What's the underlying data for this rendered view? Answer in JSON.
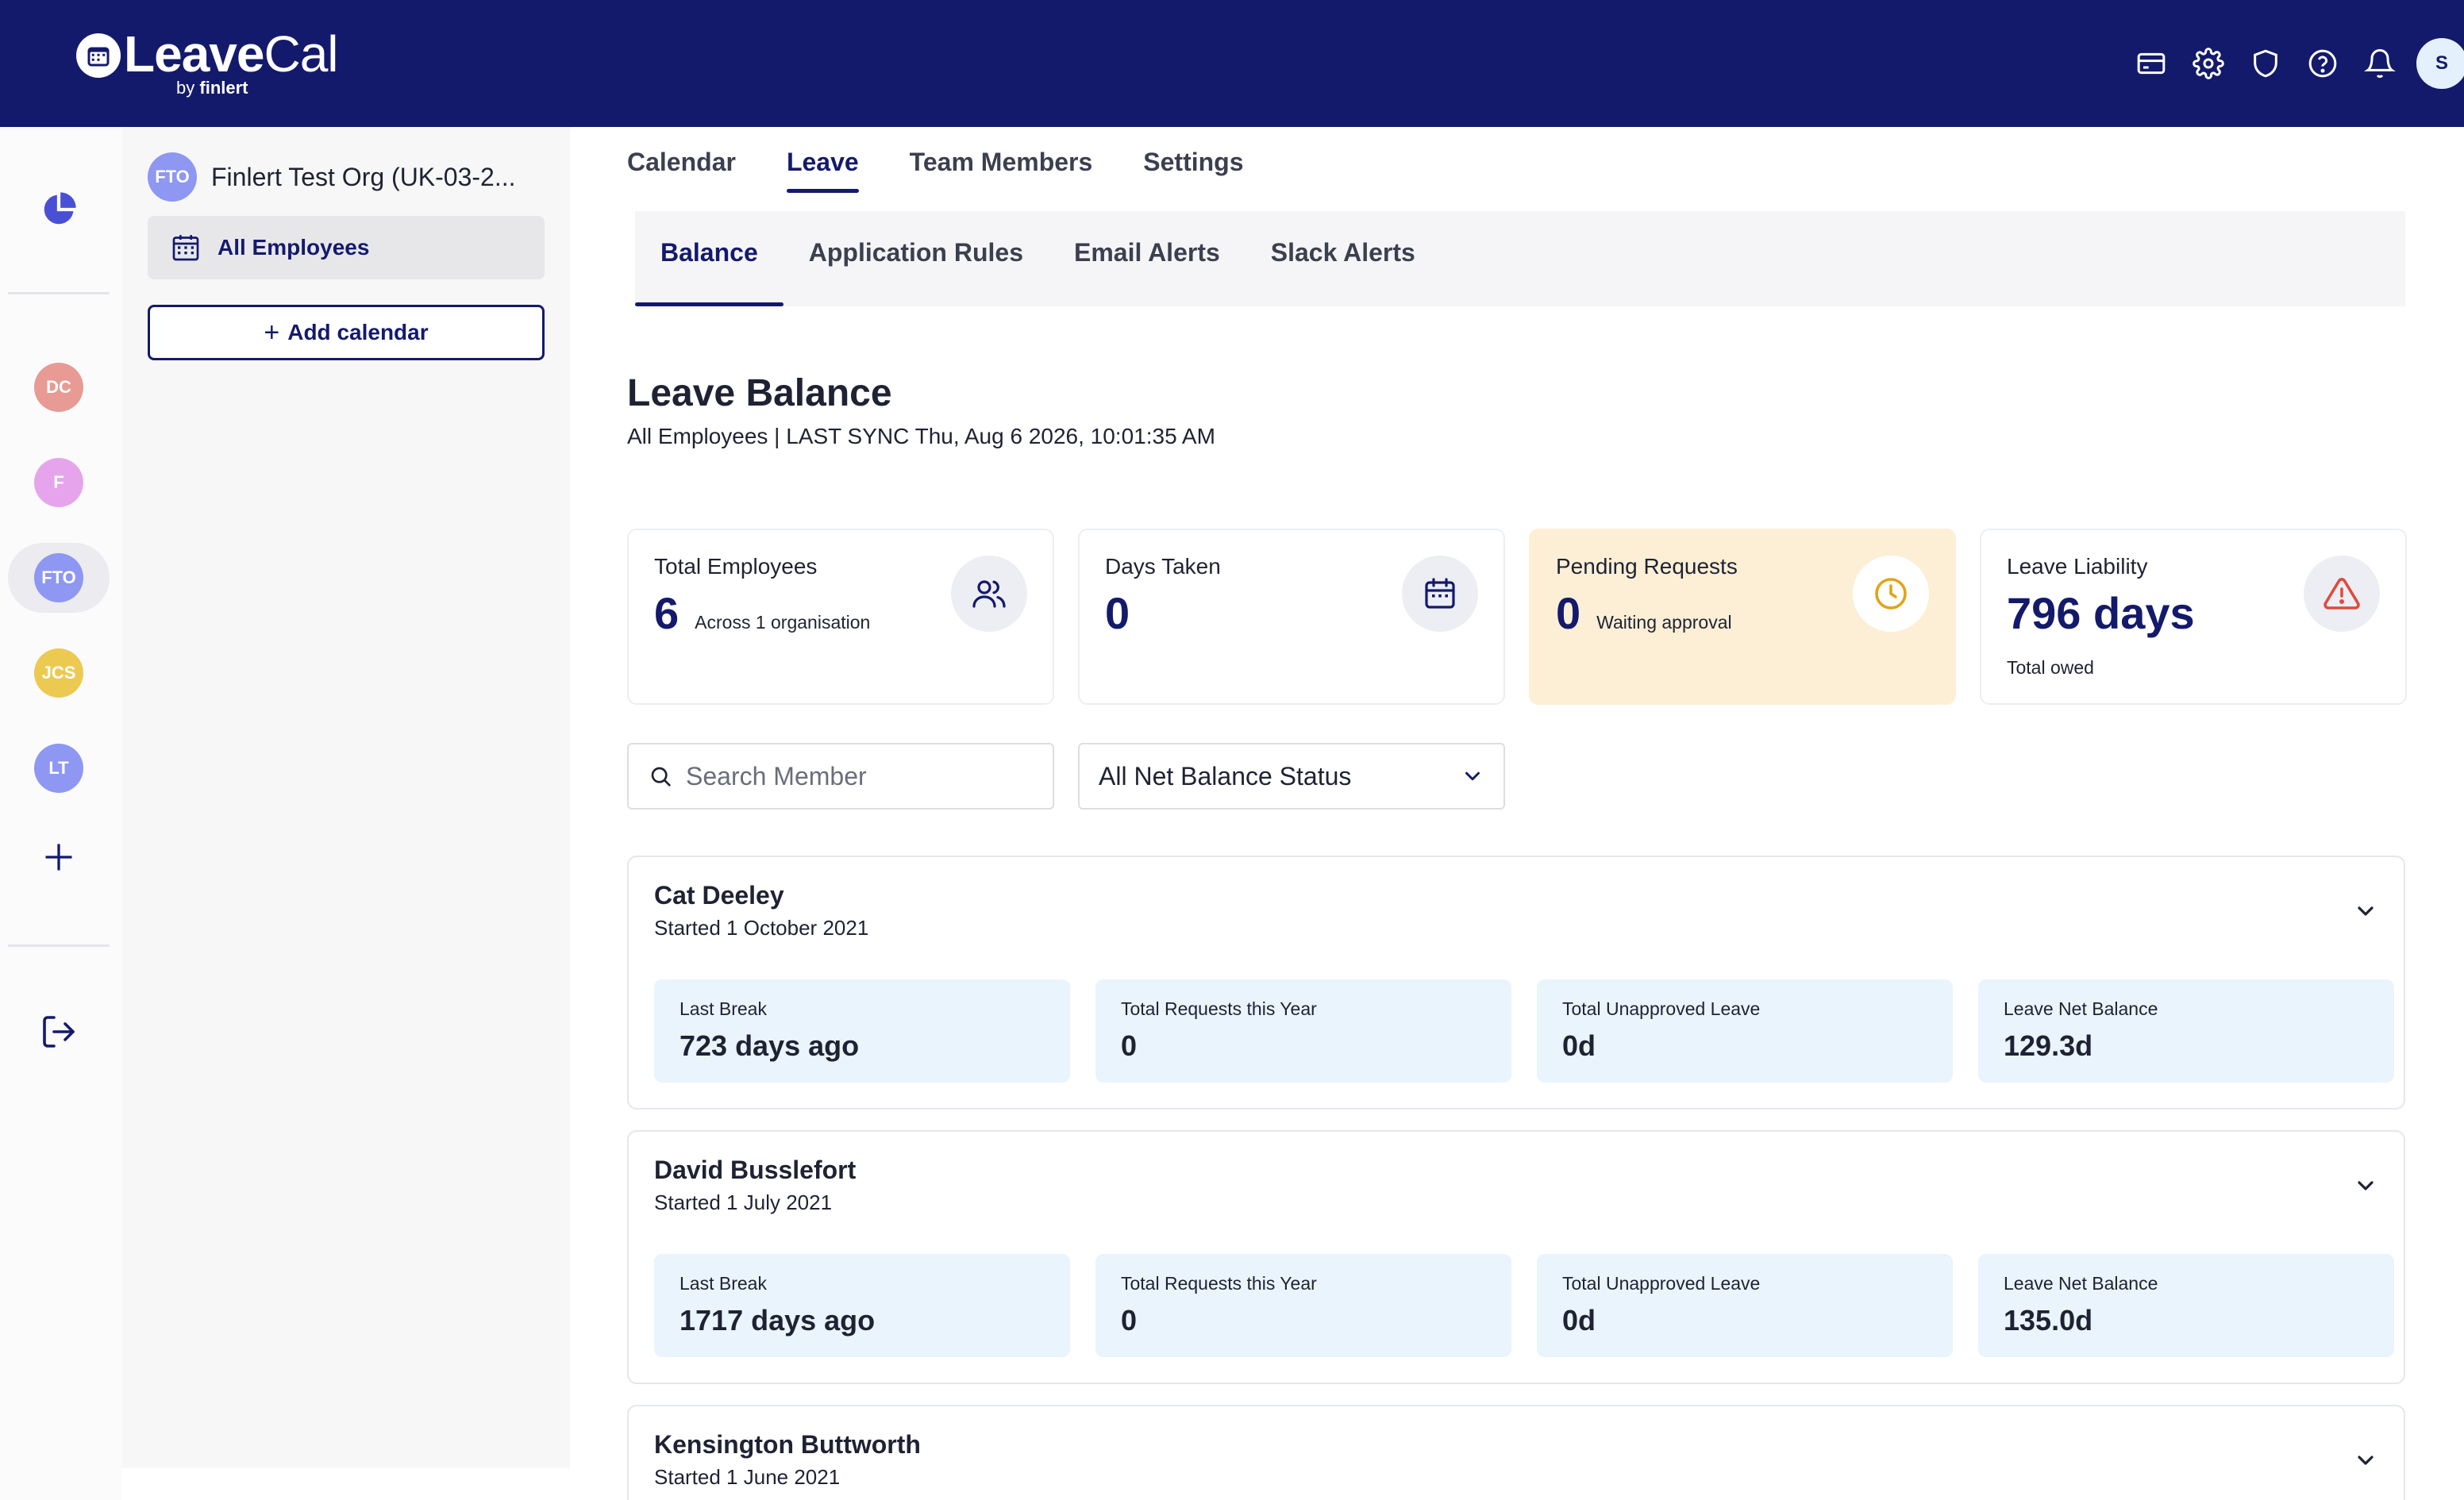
{
  "brand": {
    "name_bold": "Leave",
    "name_light": "Cal",
    "by": "by",
    "sub_bold": "finlert"
  },
  "header_icons": [
    "card-icon",
    "gear-icon",
    "shield-icon",
    "help-icon",
    "bell-icon"
  ],
  "user": {
    "initial": "S"
  },
  "rail": {
    "orgs": [
      {
        "initials": "DC",
        "color": "#e89a94"
      },
      {
        "initials": "F",
        "color": "#e6a4ec"
      },
      {
        "initials": "FTO",
        "color": "#8e97f2"
      },
      {
        "initials": "JCS",
        "color": "#ecca52"
      },
      {
        "initials": "LT",
        "color": "#8e97f2"
      }
    ]
  },
  "calpanel": {
    "org_initials": "FTO",
    "org_name": "Finlert Test Org (UK-03-2...",
    "calendar_item": "All Employees",
    "add_calendar": "Add calendar",
    "add_plus": "+"
  },
  "tabs": [
    "Calendar",
    "Leave",
    "Team Members",
    "Settings"
  ],
  "subtabs": [
    "Balance",
    "Application Rules",
    "Email Alerts",
    "Slack Alerts"
  ],
  "page": {
    "title": "Leave Balance",
    "subtitle": "All Employees | LAST SYNC Thu, Aug 6 2026, 10:01:35 AM"
  },
  "stats": [
    {
      "label": "Total Employees",
      "value": "6",
      "note": "Across 1 organisation",
      "icon": "users-icon"
    },
    {
      "label": "Days Taken",
      "value": "0",
      "note": "",
      "icon": "calendar-icon"
    },
    {
      "label": "Pending Requests",
      "value": "0",
      "note": "Waiting approval",
      "icon": "clock-icon"
    },
    {
      "label": "Leave Liability",
      "value": "796 days",
      "note": "Total owed",
      "icon": "alert-icon"
    }
  ],
  "filters": {
    "search_placeholder": "Search Member",
    "status_selected": "All Net Balance Status"
  },
  "metric_labels": [
    "Last Break",
    "Total Requests this Year",
    "Total Unapproved Leave",
    "Leave Net Balance"
  ],
  "members": [
    {
      "name": "Cat Deeley",
      "started": "Started 1 October 2021",
      "values": [
        "723 days ago",
        "0",
        "0d",
        "129.3d"
      ]
    },
    {
      "name": "David Busslefort",
      "started": "Started 1 July 2021",
      "values": [
        "1717 days ago",
        "0",
        "0d",
        "135.0d"
      ]
    },
    {
      "name": "Kensington Buttworth",
      "started": "Started 1 June 2021",
      "values": []
    }
  ]
}
